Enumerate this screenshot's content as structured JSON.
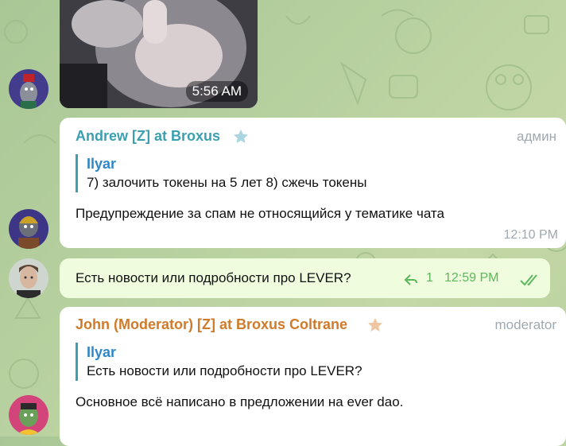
{
  "messages": {
    "video": {
      "time": "5:56 AM"
    },
    "andrew": {
      "sender": "Andrew [Z] at Broxus",
      "role": "админ",
      "reply_name": "Ilyar",
      "reply_text": "7) залочить токены на 5 лет 8) сжечь токены",
      "text": "Предупреждение за спам не относящийся у тематике чата",
      "time": "12:10 PM"
    },
    "outgoing": {
      "text": "Есть новости или подробности про LEVER?",
      "reply_count": "1",
      "time": "12:59 PM"
    },
    "john": {
      "sender": "John (Moderator) [Z] at Broxus Coltrane",
      "role": "moderator",
      "reply_name": "Ilyar",
      "reply_text": "Есть новости или подробности про LEVER?",
      "text": "Основное всё написано в предложении на ever dao."
    }
  },
  "colors": {
    "andrew_name": "#3a9fb1",
    "john_name": "#d07a2a",
    "reply_bar_blue": "#3a9fb1",
    "reply_name_blue": "#2e87c8",
    "outgoing_bg": "#effdde",
    "check_green": "#5cb85c"
  },
  "icons": {
    "andrew_star": "star-icon",
    "john_star": "star-icon",
    "reply_arrow": "reply-arrow-icon",
    "read_checks": "double-check-icon"
  }
}
